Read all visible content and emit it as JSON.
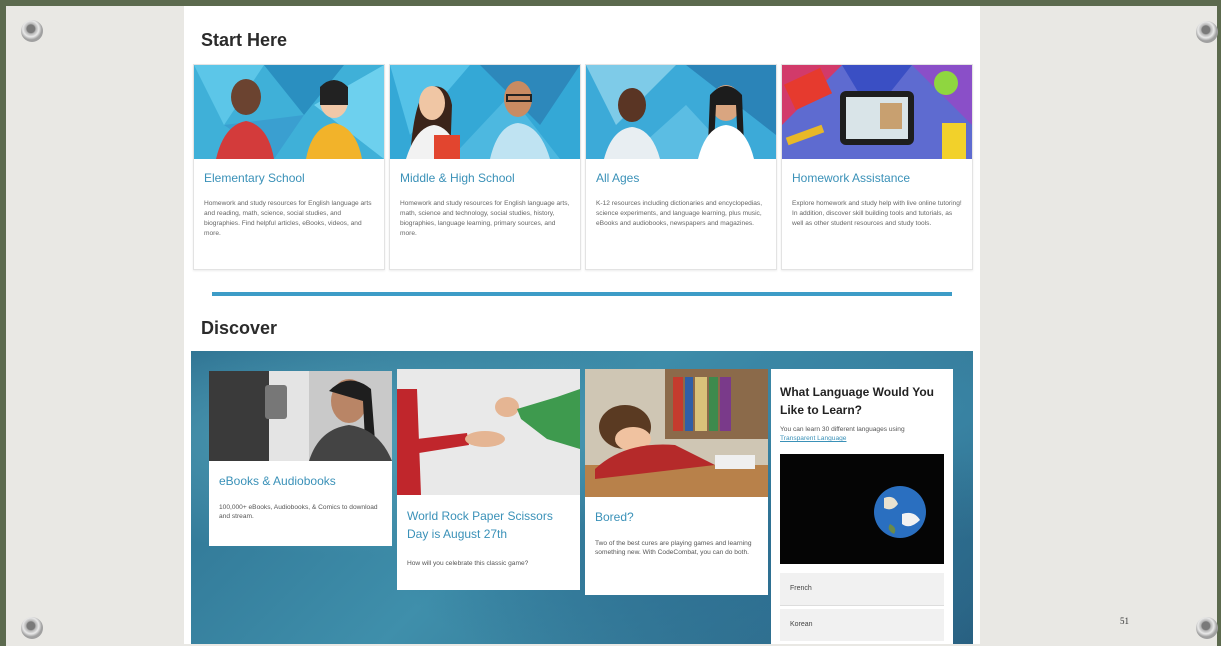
{
  "start_here": {
    "title": "Start Here",
    "cards": [
      {
        "title": "Elementary School",
        "desc": "Homework and study resources for English language arts and reading, math, science, social studies, and biographies. Find helpful articles, eBooks, videos, and more."
      },
      {
        "title": "Middle & High School",
        "desc": "Homework and study resources for English language arts, math, science and technology, social studies, history, biographies, language learning, primary sources, and more."
      },
      {
        "title": "All Ages",
        "desc": "K-12 resources including dictionaries and encyclopedias, science experiments, and language learning, plus music, eBooks and audiobooks, newspapers and magazines."
      },
      {
        "title": "Homework Assistance",
        "desc": "Explore homework and study help with live online tutoring! In addition, discover skill building tools and tutorials, as well as other student resources and study tools."
      }
    ]
  },
  "discover": {
    "title": "Discover",
    "cards": [
      {
        "title": "eBooks & Audiobooks",
        "desc": "100,000+ eBooks, Audiobooks, & Comics to download and stream."
      },
      {
        "title": "World Rock Paper Scissors Day is August 27th",
        "desc": "How will you celebrate this classic game?"
      },
      {
        "title": "Bored?",
        "desc": "Two of the best cures are playing games and learning something new. With CodeCombat, you can do both."
      }
    ],
    "language": {
      "title": "What Language Would You Like to Learn?",
      "desc_prefix": "You can learn 30 different languages using",
      "link": "Transparent Language",
      "options": [
        "French",
        "Korean"
      ]
    }
  },
  "page_number": "51"
}
